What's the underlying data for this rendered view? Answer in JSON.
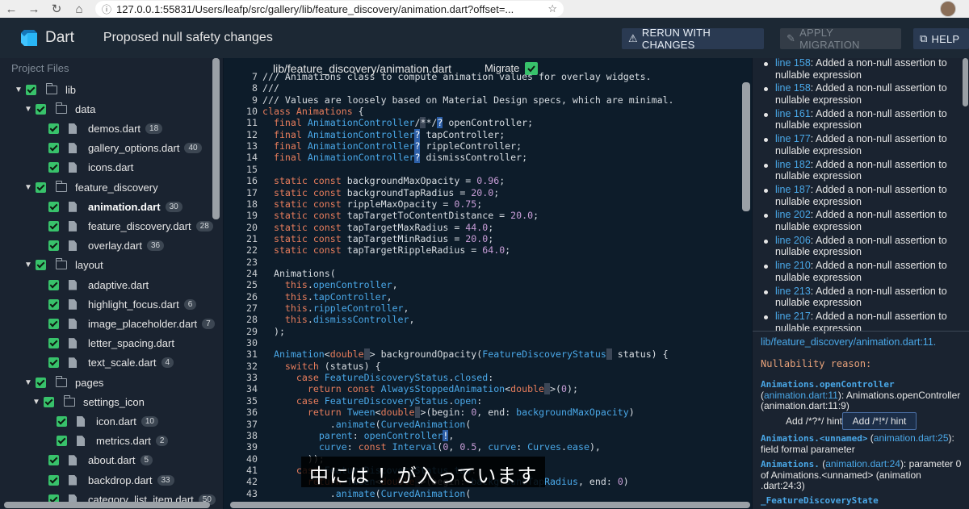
{
  "browser": {
    "back": "←",
    "forward": "→",
    "reload": "↻",
    "home": "⌂",
    "url": "127.0.0.1:55831/Users/leafp/src/gallery/lib/feature_discovery/animation.dart?offset=...",
    "star": "☆"
  },
  "header": {
    "brand": "Dart",
    "title": "Proposed null safety changes",
    "rerun_label": "RERUN WITH CHANGES",
    "apply_label": "APPLY MIGRATION",
    "help_label": "HELP"
  },
  "left_panel": {
    "title": "Project Files",
    "tree": [
      {
        "label": "lib",
        "kind": "folder",
        "depth": 0,
        "expanded": true
      },
      {
        "label": "data",
        "kind": "folder",
        "depth": 1,
        "expanded": true
      },
      {
        "label": "demos.dart",
        "kind": "file",
        "depth": 2,
        "badge": "18"
      },
      {
        "label": "gallery_options.dart",
        "kind": "file",
        "depth": 2,
        "badge": "40"
      },
      {
        "label": "icons.dart",
        "kind": "file",
        "depth": 2,
        "badge": ""
      },
      {
        "label": "feature_discovery",
        "kind": "folder",
        "depth": 1,
        "expanded": true
      },
      {
        "label": "animation.dart",
        "kind": "file",
        "depth": 2,
        "badge": "30",
        "selected": true
      },
      {
        "label": "feature_discovery.dart",
        "kind": "file",
        "depth": 2,
        "badge": "28"
      },
      {
        "label": "overlay.dart",
        "kind": "file",
        "depth": 2,
        "badge": "36"
      },
      {
        "label": "layout",
        "kind": "folder",
        "depth": 1,
        "expanded": true
      },
      {
        "label": "adaptive.dart",
        "kind": "file",
        "depth": 2,
        "badge": ""
      },
      {
        "label": "highlight_focus.dart",
        "kind": "file",
        "depth": 2,
        "badge": "6"
      },
      {
        "label": "image_placeholder.dart",
        "kind": "file",
        "depth": 2,
        "badge": "7"
      },
      {
        "label": "letter_spacing.dart",
        "kind": "file",
        "depth": 2,
        "badge": ""
      },
      {
        "label": "text_scale.dart",
        "kind": "file",
        "depth": 2,
        "badge": "4"
      },
      {
        "label": "pages",
        "kind": "folder",
        "depth": 1,
        "expanded": true
      },
      {
        "label": "settings_icon",
        "kind": "folder",
        "depth": 2,
        "expanded": true
      },
      {
        "label": "icon.dart",
        "kind": "file",
        "depth": 3,
        "badge": "10"
      },
      {
        "label": "metrics.dart",
        "kind": "file",
        "depth": 3,
        "badge": "2"
      },
      {
        "label": "about.dart",
        "kind": "file",
        "depth": 2,
        "badge": "5"
      },
      {
        "label": "backdrop.dart",
        "kind": "file",
        "depth": 2,
        "badge": "33"
      },
      {
        "label": "category_list_item.dart",
        "kind": "file",
        "depth": 2,
        "badge": "50"
      }
    ]
  },
  "editor": {
    "file_path": "lib/feature_discovery/animation.dart",
    "migrate_label": "Migrate",
    "lines": [
      {
        "n": "7",
        "html": "<span class='fn'>/// Animations class to compute animation values for overlay widgets.</span>"
      },
      {
        "n": "8",
        "html": "///"
      },
      {
        "n": "9",
        "html": "/// Values are loosely based on Material Design specs, which are minimal."
      },
      {
        "n": "10",
        "html": "<span class='kw'>class</span> <span class='kw'>Animations</span> {"
      },
      {
        "n": "11",
        "html": "  <span class='kw'>final</span> <span class='ty'>AnimationController</span>/<span class='hl2'>*</span>*/<span class='hl'>?</span> openController;"
      },
      {
        "n": "12",
        "html": "  <span class='kw'>final</span> <span class='ty'>AnimationController</span><span class='hl'>?</span> tapController;"
      },
      {
        "n": "13",
        "html": "  <span class='kw'>final</span> <span class='ty'>AnimationController</span><span class='hl'>?</span> rippleController;"
      },
      {
        "n": "14",
        "html": "  <span class='kw'>final</span> <span class='ty'>AnimationController</span><span class='hl'>?</span> dismissController;"
      },
      {
        "n": "15",
        "html": ""
      },
      {
        "n": "16",
        "html": "  <span class='kw'>static const</span> backgroundMaxOpacity = <span class='num'>0.96</span>;"
      },
      {
        "n": "17",
        "html": "  <span class='kw'>static const</span> backgroundTapRadius = <span class='num'>20.0</span>;"
      },
      {
        "n": "18",
        "html": "  <span class='kw'>static const</span> rippleMaxOpacity = <span class='num'>0.75</span>;"
      },
      {
        "n": "19",
        "html": "  <span class='kw'>static const</span> tapTargetToContentDistance = <span class='num'>20.0</span>;"
      },
      {
        "n": "20",
        "html": "  <span class='kw'>static const</span> tapTargetMaxRadius = <span class='num'>44.0</span>;"
      },
      {
        "n": "21",
        "html": "  <span class='kw'>static const</span> tapTargetMinRadius = <span class='num'>20.0</span>;"
      },
      {
        "n": "22",
        "html": "  <span class='kw'>static const</span> tapTargetRippleRadius = <span class='num'>64.0</span>;"
      },
      {
        "n": "23",
        "html": ""
      },
      {
        "n": "24",
        "html": "  Animations("
      },
      {
        "n": "25",
        "html": "    <span class='kw'>this</span>.<span class='mem'>openController</span>,"
      },
      {
        "n": "26",
        "html": "    <span class='kw'>this</span>.<span class='mem'>tapController</span>,"
      },
      {
        "n": "27",
        "html": "    <span class='kw'>this</span>.<span class='mem'>rippleController</span>,"
      },
      {
        "n": "28",
        "html": "    <span class='kw'>this</span>.<span class='mem'>dismissController</span>,"
      },
      {
        "n": "29",
        "html": "  );"
      },
      {
        "n": "30",
        "html": ""
      },
      {
        "n": "31",
        "html": "  <span class='ty'>Animation</span>&lt;<span class='kw'>double</span><span class='hl2'> </span>&gt; backgroundOpacity(<span class='ty'>FeatureDiscoveryStatus</span><span class='hl2'> </span> status) {"
      },
      {
        "n": "32",
        "html": "    <span class='kw'>switch</span> (status) {"
      },
      {
        "n": "33",
        "html": "      <span class='kw'>case</span> <span class='ty'>FeatureDiscoveryStatus</span>.<span class='mem'>closed</span>:"
      },
      {
        "n": "34",
        "html": "        <span class='kw'>return const</span> <span class='ty'>AlwaysStoppedAnimation</span>&lt;<span class='kw'>double</span><span class='hl2'> </span>&gt;(<span class='num'>0</span>);"
      },
      {
        "n": "35",
        "html": "      <span class='kw'>case</span> <span class='ty'>FeatureDiscoveryStatus</span>.<span class='mem'>open</span>:"
      },
      {
        "n": "36",
        "html": "        <span class='kw'>return</span> <span class='ty'>Tween</span>&lt;<span class='kw'>double</span><span class='hl2'> </span>&gt;(begin: <span class='num'>0</span>, end: <span class='mem'>backgroundMaxOpacity</span>)"
      },
      {
        "n": "37",
        "html": "            .<span class='mem'>animate</span>(<span class='ty'>CurvedAnimation</span>("
      },
      {
        "n": "38",
        "html": "          <span class='mem'>parent</span>: <span class='mem'>openController</span><span class='hl'>!</span>,"
      },
      {
        "n": "39",
        "html": "          <span class='mem'>curve</span>: <span class='kw'>const</span> <span class='ty'>Interval</span>(<span class='num'>0</span>, <span class='num'>0.5</span>, <span class='mem'>curve</span>: <span class='ty'>Curves</span>.<span class='mem'>ease</span>),"
      },
      {
        "n": "40",
        "html": "        ));"
      },
      {
        "n": "41",
        "html": "      <span class='kw'>case</span> <span class='ty'>FeatureDiscoveryStatus</span>.<span class='mem'>tap</span>:"
      },
      {
        "n": "42",
        "html": "        <span class='kw'>return</span> <span class='ty'>Tween</span>&lt;<span class='kw'>double</span><span class='hl2'> </span>&gt;(begin: <span class='mem'>backgroundTapRadius</span>, end: <span class='num'>0</span>)"
      },
      {
        "n": "43",
        "html": "            .<span class='mem'>animate</span>(<span class='ty'>CurvedAnimation</span>("
      }
    ],
    "subtitle": "中には ！が入っています"
  },
  "right_panel": {
    "edits": [
      {
        "line": "line 158",
        "text": ": Added a non-null assertion to nullable expression"
      },
      {
        "line": "line 158",
        "text": ": Added a non-null assertion to nullable expression"
      },
      {
        "line": "line 161",
        "text": ": Added a non-null assertion to nullable expression"
      },
      {
        "line": "line 177",
        "text": ": Added a non-null assertion to nullable expression"
      },
      {
        "line": "line 182",
        "text": ": Added a non-null assertion to nullable expression"
      },
      {
        "line": "line 187",
        "text": ": Added a non-null assertion to nullable expression"
      },
      {
        "line": "line 202",
        "text": ": Added a non-null assertion to nullable expression"
      },
      {
        "line": "line 206",
        "text": ": Added a non-null assertion to nullable expression"
      },
      {
        "line": "line 210",
        "text": ": Added a non-null assertion to nullable expression"
      },
      {
        "line": "line 213",
        "text": ": Added a non-null assertion to nullable expression"
      },
      {
        "line": "line 217",
        "text": ": Added a non-null assertion to nullable expression"
      }
    ],
    "detail_path": "lib/feature_discovery/animation.dart:11.",
    "reason_header": "Nullability reason:",
    "reason1_code": "Animations.openController",
    "reason1_link": "animation.dart:11",
    "reason1_text": "): Animations.openController (animation.dart:11:9)",
    "hint1": "Add /*?*/ hint",
    "hint2": "Add /*!*/ hint",
    "reason2_code": "Animations.<unnamed>",
    "reason2_link": "animation.dart:25",
    "reason2_text": "):",
    "reason2_line2": "field formal parameter",
    "reason3_code": "Animations.",
    "reason3_link": "animation.dart:24",
    "reason3_text": "): parameter 0 of Animations.<unnamed> (animation .dart:24:3)",
    "reason4_code": "_FeatureDiscoveryState"
  },
  "colors": {
    "accent": "#4aa8e8",
    "check": "#38c26b",
    "keyword": "#e87d5c"
  }
}
